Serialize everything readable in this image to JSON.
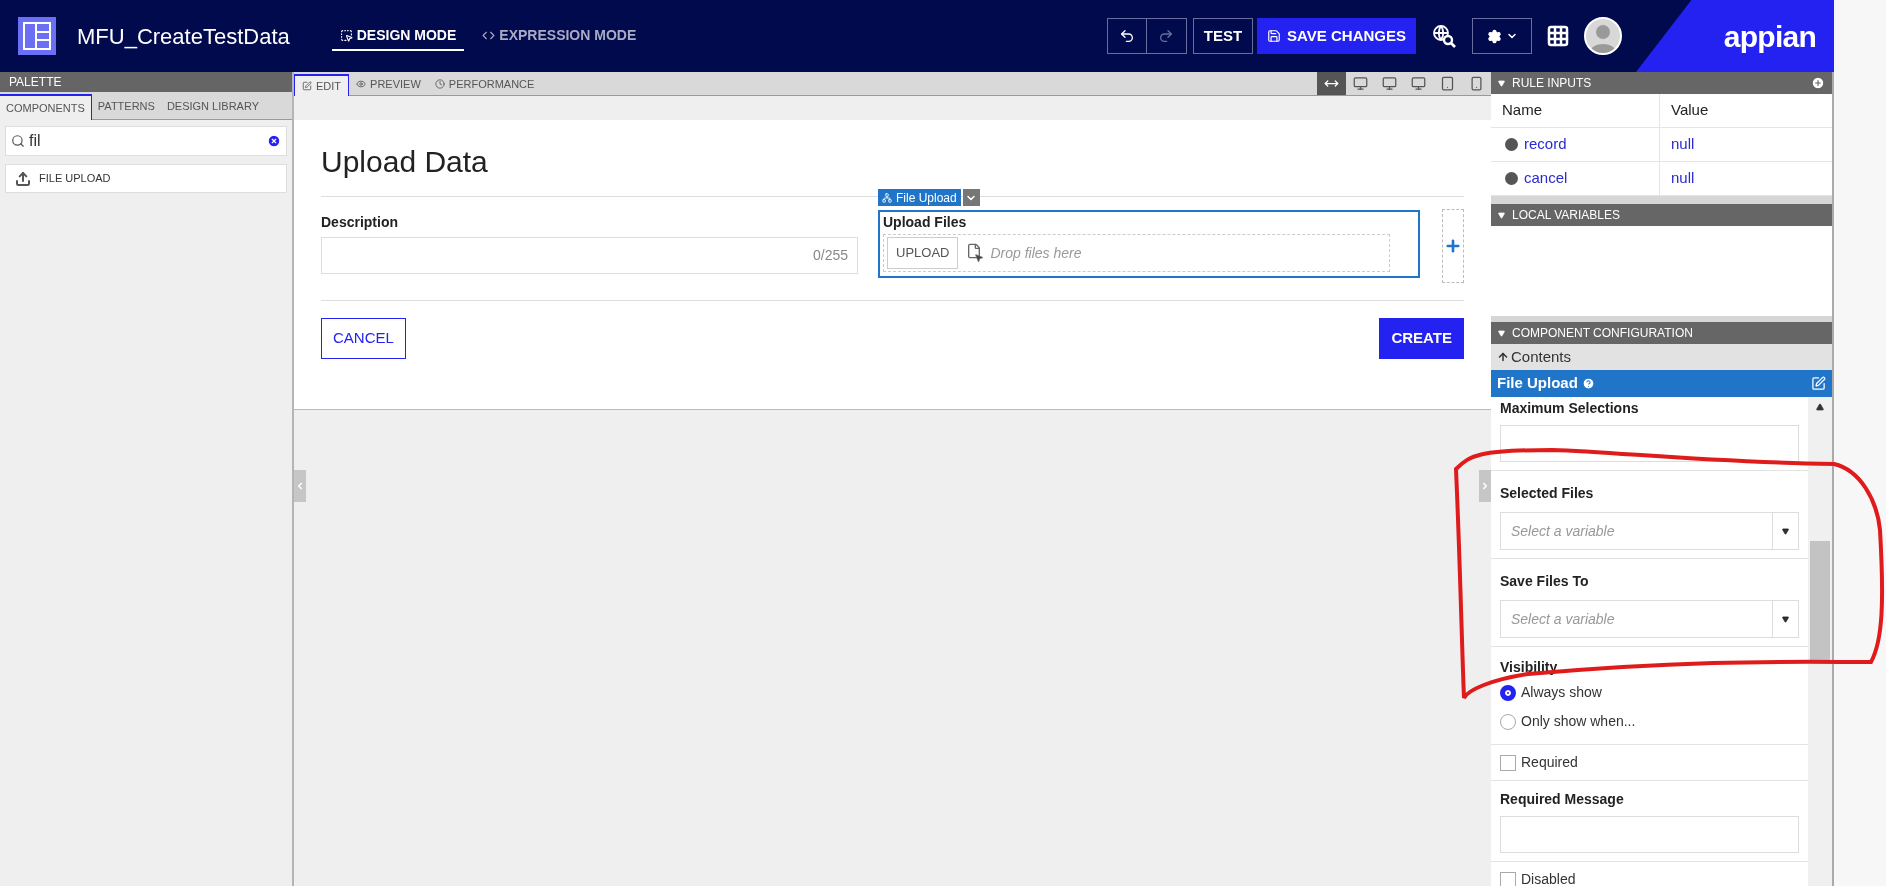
{
  "app_bar": {
    "title": "MFU_CreateTestData",
    "modes": [
      {
        "label": "DESIGN MODE",
        "selected": true
      },
      {
        "label": "EXPRESSION MODE",
        "selected": false
      }
    ],
    "undo": {
      "disabled": false
    },
    "redo": {
      "disabled": true
    },
    "test_button": "TEST",
    "save_button": "SAVE CHANGES",
    "logo": "appian"
  },
  "palette": {
    "title": "PALETTE",
    "tabs": [
      {
        "label": "COMPONENTS",
        "selected": true
      },
      {
        "label": "PATTERNS",
        "selected": false
      },
      {
        "label": "DESIGN LIBRARY",
        "selected": false
      }
    ],
    "search": {
      "value": "fil"
    },
    "results": [
      "FILE UPLOAD"
    ]
  },
  "editor": {
    "tabs": [
      {
        "label": "EDIT",
        "selected": true
      },
      {
        "label": "PREVIEW",
        "selected": false
      },
      {
        "label": "PERFORMANCE",
        "selected": false
      }
    ],
    "devices": [
      {
        "selected": true
      },
      {
        "selected": false
      },
      {
        "selected": false
      },
      {
        "selected": false
      },
      {
        "selected": false
      },
      {
        "selected": false
      }
    ]
  },
  "form": {
    "title": "Upload Data",
    "description": {
      "label": "Description",
      "counter": "0/255"
    },
    "file_upload": {
      "tag": "File Upload",
      "label": "Upload Files",
      "button": "UPLOAD",
      "placeholder": "Drop files here"
    },
    "cancel": "CANCEL",
    "create": "CREATE"
  },
  "rule_inputs": {
    "title": "RULE INPUTS",
    "columns": [
      "Name",
      "Value"
    ],
    "rows": [
      {
        "name": "record",
        "value": "null"
      },
      {
        "name": "cancel",
        "value": "null"
      }
    ]
  },
  "local_variables": {
    "title": "LOCAL VARIABLES"
  },
  "component_configuration": {
    "title": "COMPONENT CONFIGURATION",
    "breadcrumb": "Contents",
    "component": "File Upload",
    "fields": [
      {
        "kind": "text",
        "label": "Maximum Selections"
      },
      {
        "kind": "select",
        "label": "Selected Files",
        "placeholder": "Select a variable"
      },
      {
        "kind": "select",
        "label": "Save Files To",
        "placeholder": "Select a variable"
      },
      {
        "kind": "radio",
        "label": "Visibility",
        "options": [
          {
            "label": "Always show",
            "selected": true
          },
          {
            "label": "Only show when...",
            "selected": false
          }
        ]
      },
      {
        "kind": "checkbox",
        "label": "Required",
        "checked": false
      },
      {
        "kind": "text",
        "label": "Required Message"
      },
      {
        "kind": "checkbox",
        "label": "Disabled",
        "checked": false
      }
    ]
  }
}
